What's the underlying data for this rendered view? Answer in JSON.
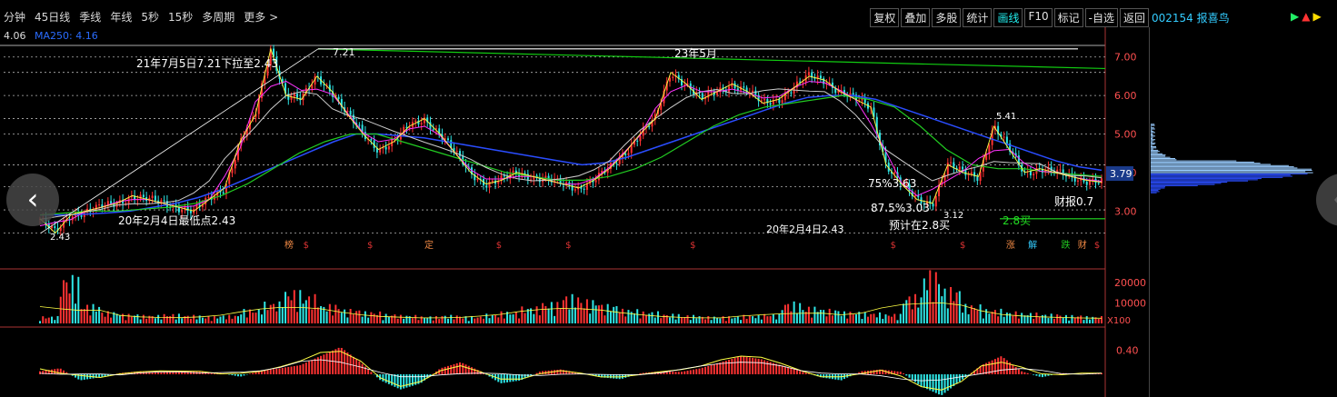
{
  "toolbar": {
    "periods": [
      "分钟",
      "45日线",
      "季线",
      "年线",
      "5秒",
      "15秒",
      "多周期",
      "更多 >"
    ],
    "tools": [
      "复权",
      "叠加",
      "多股",
      "统计",
      "画线",
      "F10",
      "标记",
      "-自选",
      "返回"
    ],
    "active_tool": "画线"
  },
  "ma_row": {
    "price": "4.06",
    "label": "MA250: 4.16"
  },
  "stock": {
    "title": "002154 报喜鸟"
  },
  "side_icons": [
    "▶",
    "▲",
    "▶"
  ],
  "nav": {
    "left": "‹"
  },
  "current_price_tag": "3.79",
  "volume_unit": "X100",
  "event_markers": [
    {
      "label": "榜",
      "x": 0.255
    },
    {
      "label": "$",
      "x": 0.272
    },
    {
      "label": "$",
      "x": 0.33
    },
    {
      "label": "定",
      "x": 0.382
    },
    {
      "label": "$",
      "x": 0.447
    },
    {
      "label": "$",
      "x": 0.51
    },
    {
      "label": "$",
      "x": 0.623
    },
    {
      "label": "$",
      "x": 0.805
    },
    {
      "label": "$",
      "x": 0.868
    },
    {
      "label": "涨",
      "x": 0.91
    },
    {
      "label": "解",
      "x": 0.93
    },
    {
      "label": "跌",
      "x": 0.96
    },
    {
      "label": "财",
      "x": 0.975
    },
    {
      "label": "$",
      "x": 0.99
    }
  ],
  "colors": {
    "up": "#ff3232",
    "down": "#2ee6e6",
    "ma250": "#2a4dff",
    "ma60": "#22cc22",
    "ma20": "#cccccc",
    "ma10": "#ff33ff",
    "ma5": "#ffff44",
    "annot": "#ffffff",
    "grid": "#ffffff"
  },
  "chart_data": [
    {
      "type": "candlestick",
      "panel": "price",
      "ylim": [
        2.3,
        7.3
      ],
      "yticks": [
        "7.00",
        "6.00",
        "5.00",
        "4.00",
        "3.00"
      ],
      "ytick_values": [
        7.0,
        6.0,
        5.0,
        4.0,
        3.0
      ],
      "dashed_levels": [
        7.0,
        6.6,
        6.0,
        5.4,
        5.0,
        4.2,
        3.63,
        3.03,
        2.43
      ],
      "series": [
        {
          "name": "close_path",
          "values": [
            2.8,
            2.43,
            2.9,
            3.0,
            3.1,
            3.2,
            3.4,
            3.3,
            3.2,
            3.1,
            3.0,
            3.3,
            3.6,
            4.8,
            5.5,
            7.21,
            6.0,
            5.9,
            6.5,
            6.1,
            5.5,
            5.0,
            4.6,
            4.8,
            5.2,
            5.4,
            5.0,
            4.5,
            4.0,
            3.7,
            3.8,
            4.0,
            3.9,
            3.8,
            3.7,
            3.6,
            3.8,
            4.1,
            4.5,
            5.0,
            5.4,
            6.6,
            6.3,
            5.9,
            6.1,
            6.3,
            6.1,
            5.8,
            5.9,
            6.2,
            6.5,
            6.4,
            6.1,
            5.9,
            5.7,
            4.2,
            3.7,
            3.3,
            3.2,
            4.2,
            4.0,
            3.9,
            5.2,
            4.6,
            4.0,
            4.1,
            4.0,
            3.9,
            3.8,
            3.75
          ]
        },
        {
          "name": "MA250",
          "values": [
            2.9,
            2.9,
            2.92,
            2.95,
            3.0,
            3.1,
            3.2,
            3.35,
            3.55,
            3.8,
            4.05,
            4.3,
            4.55,
            4.8,
            5.0,
            5.0,
            4.95,
            4.9,
            4.8,
            4.7,
            4.6,
            4.5,
            4.4,
            4.3,
            4.2,
            4.25,
            4.4,
            4.6,
            4.8,
            5.0,
            5.2,
            5.4,
            5.6,
            5.8,
            5.95,
            6.0,
            6.0,
            5.9,
            5.7,
            5.5,
            5.3,
            5.1,
            4.9,
            4.7,
            4.5,
            4.3,
            4.15,
            4.06
          ]
        },
        {
          "name": "MA60",
          "values": [
            2.9,
            2.95,
            3.0,
            3.0,
            3.05,
            3.1,
            3.2,
            3.4,
            3.7,
            4.1,
            4.5,
            4.8,
            5.0,
            5.0,
            4.8,
            4.6,
            4.4,
            4.2,
            4.0,
            3.9,
            3.8,
            3.8,
            3.9,
            4.1,
            4.4,
            4.8,
            5.2,
            5.5,
            5.7,
            5.8,
            5.9,
            6.0,
            5.9,
            5.7,
            5.2,
            4.6,
            4.2,
            4.1,
            4.1,
            4.0,
            3.95,
            3.9
          ]
        }
      ]
    },
    {
      "type": "bar",
      "panel": "volume",
      "ylim": [
        0,
        25000
      ],
      "yticks": [
        "20000",
        "10000"
      ],
      "ytick_values": [
        20000,
        10000
      ],
      "series": [
        {
          "name": "volume",
          "values": [
            3000,
            20000,
            8000,
            5000,
            4000,
            3500,
            4000,
            3500,
            3000,
            3500,
            6000,
            9000,
            14000,
            12000,
            8000,
            6000,
            5000,
            4000,
            3500,
            3000,
            3500,
            3000,
            4000,
            5000,
            7000,
            9000,
            12000,
            10000,
            8000,
            6000,
            5000,
            4000,
            3500,
            3000,
            3000,
            3500,
            4000,
            9000,
            7000,
            6000,
            5000,
            4500,
            4000,
            12000,
            22000,
            15000,
            8000,
            6000,
            5000,
            4500,
            4000,
            3500,
            3000,
            3000
          ]
        }
      ]
    },
    {
      "type": "bar",
      "panel": "macd",
      "ylim": [
        -0.5,
        0.6
      ],
      "yticks": [
        "0.40"
      ],
      "ytick_values": [
        0.4
      ],
      "series": [
        {
          "name": "macd",
          "values": [
            0.05,
            0.1,
            -0.1,
            -0.05,
            0.02,
            0.05,
            0.03,
            0.06,
            0.04,
            0.02,
            -0.04,
            0.06,
            0.1,
            0.15,
            0.3,
            0.45,
            0.2,
            -0.1,
            -0.25,
            -0.15,
            0.1,
            0.2,
            0.05,
            -0.15,
            -0.1,
            0.05,
            0.08,
            0.02,
            -0.05,
            -0.08,
            0.02,
            0.05,
            0.04,
            0.1,
            0.2,
            0.3,
            0.25,
            0.15,
            0.05,
            -0.05,
            -0.1,
            0.05,
            0.08,
            0.04,
            -0.2,
            -0.35,
            -0.1,
            0.15,
            0.3,
            0.05,
            -0.05,
            0.02,
            0.01,
            0.02
          ]
        }
      ]
    }
  ],
  "annotations": {
    "drop_note": "21年7月5日7.21下拉至2.43",
    "peak_label": "7.21",
    "low_note": "20年2月4日最低点2.43",
    "low_value": "2.43",
    "month_note": "23年5月",
    "fib75": "75%3.63",
    "fib875": "87.5%3.03",
    "low2": "3.12",
    "date_note": "20年2月4日2.43",
    "forecast": "预计在2.8买",
    "buy": "2.8买",
    "report": "财报0.7",
    "peak2": "5.41"
  }
}
